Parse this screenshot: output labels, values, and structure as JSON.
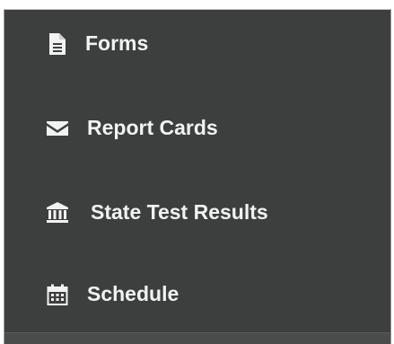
{
  "menu": {
    "items": [
      {
        "label": "Forms",
        "icon": "file-icon"
      },
      {
        "label": "Report Cards",
        "icon": "envelope-icon"
      },
      {
        "label": "State Test Results",
        "icon": "bank-icon"
      },
      {
        "label": "Schedule",
        "icon": "calendar-icon"
      }
    ]
  },
  "colors": {
    "background": "#3d3f3e",
    "text": "#f2f2f2"
  }
}
